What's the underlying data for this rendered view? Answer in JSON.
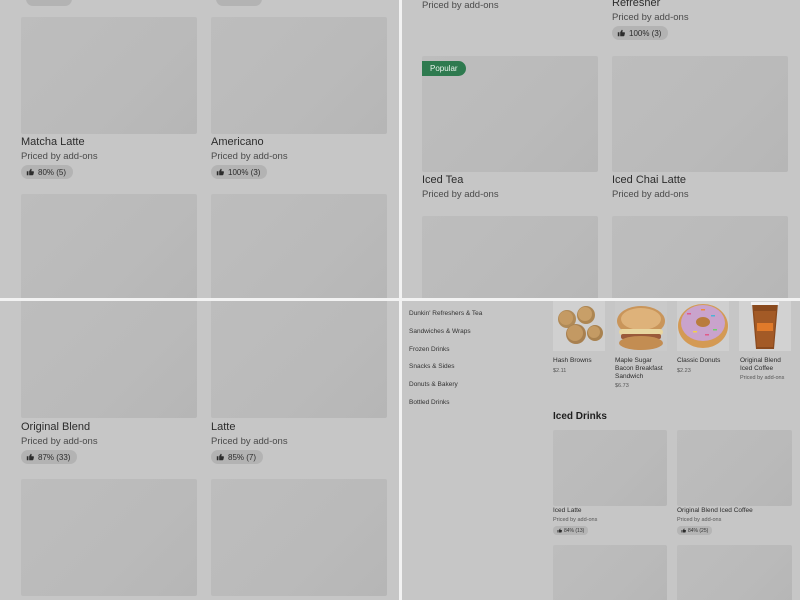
{
  "top_left": {
    "items": [
      {
        "name": "Matcha Latte",
        "price": "Priced by add-ons",
        "rating": "80% (5)"
      },
      {
        "name": "Americano",
        "price": "Priced by add-ons",
        "rating": "100% (3)"
      }
    ]
  },
  "top_right": {
    "partial_left_price": "Priced by add-ons",
    "partial_right_name": "Refresher",
    "partial_right_price": "Priced by add-ons",
    "partial_right_rating": "100% (3)",
    "popular_badge": "Popular",
    "items": [
      {
        "name": "Iced Tea",
        "price": "Priced by add-ons"
      },
      {
        "name": "Iced Chai Latte",
        "price": "Priced by add-ons"
      }
    ]
  },
  "bottom_left": {
    "items": [
      {
        "name": "Original Blend",
        "price": "Priced by add-ons",
        "rating": "87% (33)"
      },
      {
        "name": "Latte",
        "price": "Priced by add-ons",
        "rating": "85% (7)"
      }
    ]
  },
  "bottom_right": {
    "categories": [
      "Dunkin' Refreshers & Tea",
      "Sandwiches & Wraps",
      "Frozen Drinks",
      "Snacks & Sides",
      "Donuts & Bakery",
      "Bottled Drinks"
    ],
    "featured": [
      {
        "name": "Hash Browns",
        "price": "$2.11"
      },
      {
        "name": "Maple Sugar Bacon Breakfast Sandwich",
        "price": "$6.73"
      },
      {
        "name": "Classic Donuts",
        "price": "$2.23"
      },
      {
        "name": "Original Blend Iced Coffee",
        "price": "Priced by add-ons"
      }
    ],
    "section_title": "Iced Drinks",
    "iced_items": [
      {
        "name": "Iced Latte",
        "price": "Priced by add-ons",
        "rating": "84% (13)"
      },
      {
        "name": "Original Blend Iced Coffee",
        "price": "Priced by add-ons",
        "rating": "84% (25)"
      }
    ]
  },
  "icons": {
    "rating": "thumbs-up-icon"
  },
  "colors": {
    "background": "#c6c6c6",
    "popular_badge": "#2e7a4f",
    "divider": "#f2f2f2"
  }
}
